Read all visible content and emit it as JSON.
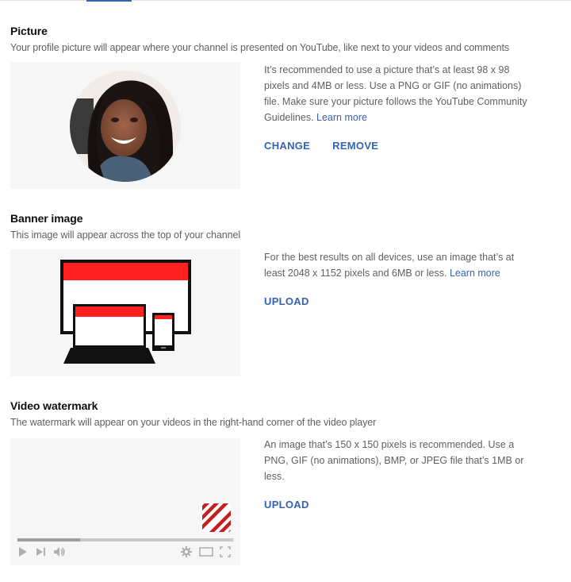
{
  "sections": {
    "picture": {
      "title": "Picture",
      "description": "Your profile picture will appear where your channel is presented on YouTube, like next to your videos and comments",
      "info_text": "It’s recommended to use a picture that’s at least 98 x 98 pixels and 4MB or less. Use a PNG or GIF (no animations) file. Make sure your picture follows the YouTube Community Guidelines.",
      "learn_more": "Learn more",
      "change_label": "CHANGE",
      "remove_label": "REMOVE"
    },
    "banner": {
      "title": "Banner image",
      "description": "This image will appear across the top of your channel",
      "info_text": "For the best results on all devices, use an image that’s at least 2048 x 1152 pixels and 6MB or less.",
      "learn_more": "Learn more",
      "upload_label": "UPLOAD"
    },
    "watermark": {
      "title": "Video watermark",
      "description": "The watermark will appear on your videos in the right-hand corner of the video player",
      "info_text": "An image that’s 150 x 150 pixels is recommended. Use a PNG, GIF (no animations), BMP, or JPEG file that’s 1MB or less.",
      "upload_label": "UPLOAD",
      "player_progress_percent": 29
    }
  },
  "colors": {
    "accent": "#3563b5",
    "brand_red": "#ff2020",
    "watermark_red": "#c4201f",
    "preview_bg": "#f6f6f6"
  }
}
